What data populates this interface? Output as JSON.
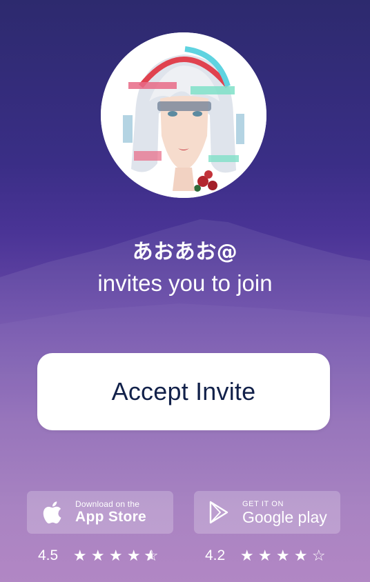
{
  "inviter": {
    "name": "あおあお@",
    "subtitle": "invites you to join"
  },
  "accept_button": {
    "label": "Accept Invite"
  },
  "app_store": {
    "small_text": "Download on the",
    "big_text": "App Store",
    "icon": "apple-icon",
    "rating": "4.5",
    "stars": 4.5
  },
  "google_play": {
    "small_text": "GET IT ON",
    "big_text": "Google play",
    "icon": "play-triangle-icon",
    "rating": "4.2",
    "stars": 4
  },
  "colors": {
    "background_top": "#2d2a6e",
    "background_bottom": "#a879bd",
    "button_text": "#12214a"
  }
}
